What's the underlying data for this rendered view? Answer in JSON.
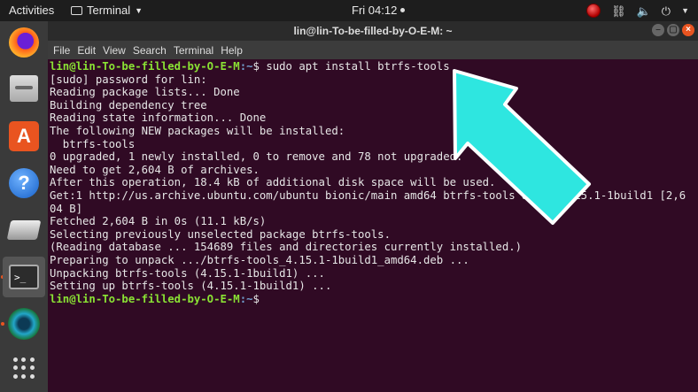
{
  "topbar": {
    "activities": "Activities",
    "app_name": "Terminal",
    "clock": "Fri 04:12"
  },
  "dock": {
    "items": [
      "firefox-icon",
      "files-icon",
      "software-icon",
      "help-icon",
      "drive-icon",
      "terminal-icon",
      "camera-icon",
      "app-grid-icon"
    ]
  },
  "window": {
    "title": "lin@lin-To-be-filled-by-O-E-M: ~",
    "menu": [
      "File",
      "Edit",
      "View",
      "Search",
      "Terminal",
      "Help"
    ]
  },
  "terminal": {
    "prompt_user": "lin@lin-To-be-filled-by-O-E-M",
    "prompt_path": ":~",
    "command": "$ sudo apt install btrfs-tools",
    "output": [
      "[sudo] password for lin:",
      "Reading package lists... Done",
      "Building dependency tree",
      "Reading state information... Done",
      "The following NEW packages will be installed:",
      "  btrfs-tools",
      "0 upgraded, 1 newly installed, 0 to remove and 78 not upgraded.",
      "Need to get 2,604 B of archives.",
      "After this operation, 18.4 kB of additional disk space will be used.",
      "Get:1 http://us.archive.ubuntu.com/ubuntu bionic/main amd64 btrfs-tools amd64 4.15.1-1build1 [2,6",
      "04 B]",
      "Fetched 2,604 B in 0s (11.1 kB/s)",
      "Selecting previously unselected package btrfs-tools.",
      "(Reading database ... 154689 files and directories currently installed.)",
      "Preparing to unpack .../btrfs-tools_4.15.1-1build1_amd64.deb ...",
      "Unpacking btrfs-tools (4.15.1-1build1) ...",
      "Setting up btrfs-tools (4.15.1-1build1) ..."
    ],
    "final_prompt_end": "$"
  },
  "colors": {
    "terminal_bg": "#300a24",
    "arrow": "#2ee6e0",
    "prompt_user": "#8ae234",
    "prompt_path": "#729fcf"
  }
}
